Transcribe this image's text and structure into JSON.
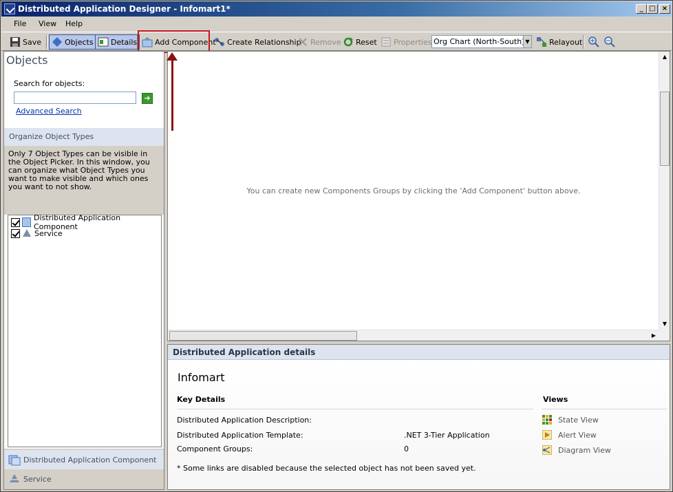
{
  "window": {
    "title": "Distributed Application Designer - Infomart1*"
  },
  "menu": [
    {
      "label": "File"
    },
    {
      "label": "View"
    },
    {
      "label": "Help"
    }
  ],
  "toolbar": {
    "save": "Save",
    "objects": "Objects",
    "details": "Details",
    "add_component": "Add Component",
    "create_relationship": "Create Relationship",
    "remove": "Remove",
    "reset": "Reset",
    "properties": "Properties",
    "layout_selected": "Org Chart (North-South)",
    "relayout": "Relayout"
  },
  "objects_pane": {
    "title": "Objects",
    "search_label": "Search for objects:",
    "search_value": "",
    "advanced_search": "Advanced Search",
    "organize_title": "Organize Object Types",
    "organize_text": "Only 7 Object Types can be visible in the Object Picker. In this window, you can organize what Object Types you want to make visible and which ones you want to not show.",
    "types": [
      {
        "label": "Distributed Application Component",
        "checked": true
      },
      {
        "label": "Service",
        "checked": true
      }
    ],
    "footer": [
      {
        "label": "Distributed Application Component"
      },
      {
        "label": "Service"
      }
    ]
  },
  "canvas": {
    "message": "You can create new Components Groups by clicking the 'Add Component' button above."
  },
  "details_pane": {
    "header": "Distributed Application details",
    "name": "Infomart",
    "key_details_title": "Key Details",
    "rows": [
      {
        "label": "Distributed Application Description:",
        "value": ""
      },
      {
        "label": "Distributed Application Template:",
        "value": ".NET 3-Tier Application"
      },
      {
        "label": "Component Groups:",
        "value": "0"
      }
    ],
    "views_title": "Views",
    "views": [
      {
        "label": "State View"
      },
      {
        "label": "Alert View"
      },
      {
        "label": "Diagram View"
      }
    ],
    "note": "* Some links are disabled because the selected object has not been saved yet."
  },
  "colors": {
    "highlight": "#c0181e",
    "arrow": "#8b1212",
    "selected": "#b9c7e8"
  }
}
